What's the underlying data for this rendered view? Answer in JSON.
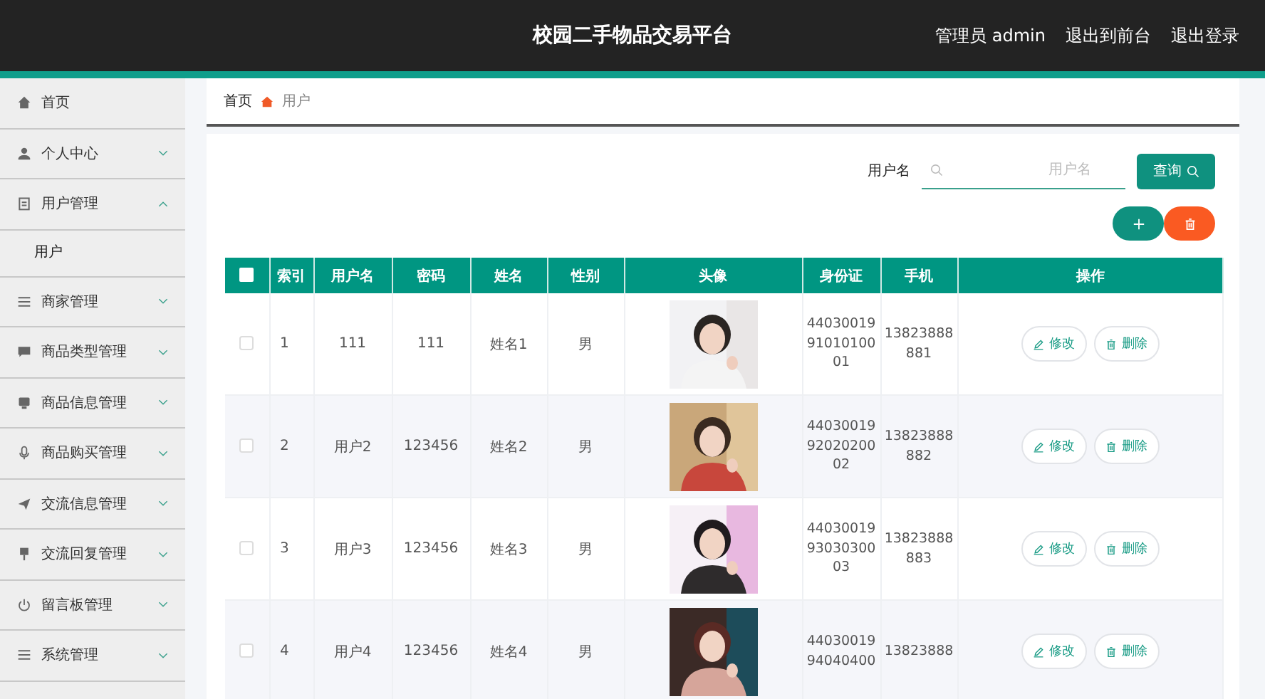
{
  "header": {
    "title": "校园二手物品交易平台",
    "links": [
      "管理员 admin",
      "退出到前台",
      "退出登录"
    ]
  },
  "sidebar": {
    "items": [
      {
        "label": "首页"
      },
      {
        "label": "个人中心",
        "expanded": false
      },
      {
        "label": "用户管理",
        "expanded": true,
        "children": [
          {
            "label": "用户"
          }
        ]
      },
      {
        "label": "商家管理",
        "expanded": false
      },
      {
        "label": "商品类型管理",
        "expanded": false
      },
      {
        "label": "商品信息管理",
        "expanded": false
      },
      {
        "label": "商品购买管理",
        "expanded": false
      },
      {
        "label": "交流信息管理",
        "expanded": false
      },
      {
        "label": "交流回复管理",
        "expanded": false
      },
      {
        "label": "留言板管理",
        "expanded": false
      },
      {
        "label": "系统管理",
        "expanded": false
      }
    ]
  },
  "breadcrumb": [
    "首页",
    "用户"
  ],
  "search": {
    "label": "用户名",
    "placeholder": "用户名",
    "button": "查询"
  },
  "table": {
    "header_checked": false,
    "columns": [
      "索引",
      "用户名",
      "密码",
      "姓名",
      "性别",
      "头像",
      "身份证",
      "手机",
      "操作"
    ],
    "rows": [
      {
        "checked": false,
        "cells": [
          "1",
          "111",
          "111",
          "姓名1",
          "男"
        ],
        "avatar": {
          "kind": "picture"
        },
        "id_card": "440300199101010001",
        "phone": "13823888881",
        "actions": [
          "修改",
          "删除"
        ]
      },
      {
        "checked": false,
        "cells": [
          "2",
          "用户2",
          "123456",
          "姓名2",
          "男"
        ],
        "avatar": {
          "kind": "picture"
        },
        "id_card": "440300199202020002",
        "phone": "13823888882",
        "actions": [
          "修改",
          "删除"
        ]
      },
      {
        "checked": false,
        "cells": [
          "3",
          "用户3",
          "123456",
          "姓名3",
          "男"
        ],
        "avatar": {
          "kind": "picture"
        },
        "id_card": "440300199303030003",
        "phone": "13823888883",
        "actions": [
          "修改",
          "删除"
        ]
      },
      {
        "checked": false,
        "cells": [
          "4",
          "用户4",
          "123456",
          "姓名4",
          "男"
        ],
        "avatar": {
          "kind": "picture"
        },
        "id_card": "4403001994040400",
        "phone": "13823888",
        "actions": [
          "修改",
          "删除"
        ]
      }
    ]
  }
}
